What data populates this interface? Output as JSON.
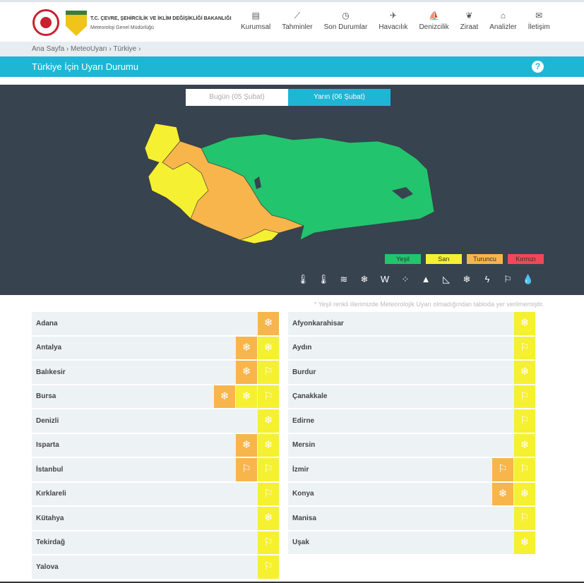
{
  "header": {
    "ministry": "T.C. ÇEVRE, ŞEHİRCİLİK VE İKLİM DEĞİŞİKLİĞİ BAKANLIĞI",
    "org": "Meteoroloji Genel Müdürlüğü",
    "nav": [
      {
        "label": "Kurumsal",
        "icon": "▤"
      },
      {
        "label": "Tahminler",
        "icon": "⟋"
      },
      {
        "label": "Son Durumlar",
        "icon": "◷"
      },
      {
        "label": "Havacılık",
        "icon": "✈"
      },
      {
        "label": "Denizcilik",
        "icon": "⛵"
      },
      {
        "label": "Ziraat",
        "icon": "❦"
      },
      {
        "label": "Analizler",
        "icon": "⌂"
      },
      {
        "label": "İletişim",
        "icon": "✉"
      }
    ]
  },
  "breadcrumb": "Ana Sayfa › MeteoUyarı › Türkiye ›",
  "title": "Türkiye İçin Uyarı Durumu",
  "help": "?",
  "tabs": {
    "today": "Bugün (05 Şubat)",
    "tomorrow": "Yarın (06 Şubat)"
  },
  "legend": [
    {
      "label": "Yeşil",
      "color": "#22c46e"
    },
    {
      "label": "Sarı",
      "color": "#f5f032"
    },
    {
      "label": "Turuncu",
      "color": "#f7b54c"
    },
    {
      "label": "Kırmızı",
      "color": "#f04858"
    }
  ],
  "hazard_icons": [
    "cold",
    "hot",
    "fog",
    "snow-ice",
    "dust",
    "wind-rain",
    "avalanche",
    "landslide",
    "snow",
    "thunder",
    "wind",
    "rain"
  ],
  "note": "* Yeşil renkli illerimizde Meteorolojik Uyarı olmadığından tabloda yer verilmemiştir.",
  "colors": {
    "orange": "#f7b54c",
    "yellow": "#f5f032"
  },
  "left": [
    {
      "name": "Adana",
      "w": [
        [
          "orange",
          "snow"
        ]
      ]
    },
    {
      "name": "Antalya",
      "w": [
        [
          "orange",
          "snow"
        ],
        [
          "yellow",
          "snow"
        ]
      ]
    },
    {
      "name": "Balıkesir",
      "w": [
        [
          "orange",
          "snow"
        ],
        [
          "yellow",
          "wind"
        ]
      ]
    },
    {
      "name": "Bursa",
      "w": [
        [
          "orange",
          "snow"
        ],
        [
          "yellow",
          "snow"
        ],
        [
          "yellow",
          "wind"
        ]
      ]
    },
    {
      "name": "Denizli",
      "w": [
        [
          "yellow",
          "snow"
        ]
      ]
    },
    {
      "name": "Isparta",
      "w": [
        [
          "orange",
          "snow"
        ],
        [
          "yellow",
          "snow"
        ]
      ]
    },
    {
      "name": "İstanbul",
      "w": [
        [
          "orange",
          "wind"
        ],
        [
          "yellow",
          "wind"
        ]
      ]
    },
    {
      "name": "Kırklareli",
      "w": [
        [
          "yellow",
          "wind"
        ]
      ]
    },
    {
      "name": "Kütahya",
      "w": [
        [
          "yellow",
          "snow"
        ]
      ]
    },
    {
      "name": "Tekirdağ",
      "w": [
        [
          "yellow",
          "wind"
        ]
      ]
    },
    {
      "name": "Yalova",
      "w": [
        [
          "yellow",
          "wind"
        ]
      ]
    }
  ],
  "right": [
    {
      "name": "Afyonkarahisar",
      "w": [
        [
          "yellow",
          "snow"
        ]
      ]
    },
    {
      "name": "Aydın",
      "w": [
        [
          "yellow",
          "wind"
        ]
      ]
    },
    {
      "name": "Burdur",
      "w": [
        [
          "yellow",
          "snow"
        ]
      ]
    },
    {
      "name": "Çanakkale",
      "w": [
        [
          "yellow",
          "wind"
        ]
      ]
    },
    {
      "name": "Edirne",
      "w": [
        [
          "yellow",
          "wind"
        ]
      ]
    },
    {
      "name": "Mersin",
      "w": [
        [
          "yellow",
          "snow"
        ]
      ]
    },
    {
      "name": "İzmir",
      "w": [
        [
          "orange",
          "wind"
        ],
        [
          "yellow",
          "wind"
        ]
      ]
    },
    {
      "name": "Konya",
      "w": [
        [
          "orange",
          "snow"
        ],
        [
          "yellow",
          "snow"
        ]
      ]
    },
    {
      "name": "Manisa",
      "w": [
        [
          "yellow",
          "wind"
        ]
      ]
    },
    {
      "name": "Uşak",
      "w": [
        [
          "yellow",
          "snow"
        ]
      ]
    }
  ]
}
